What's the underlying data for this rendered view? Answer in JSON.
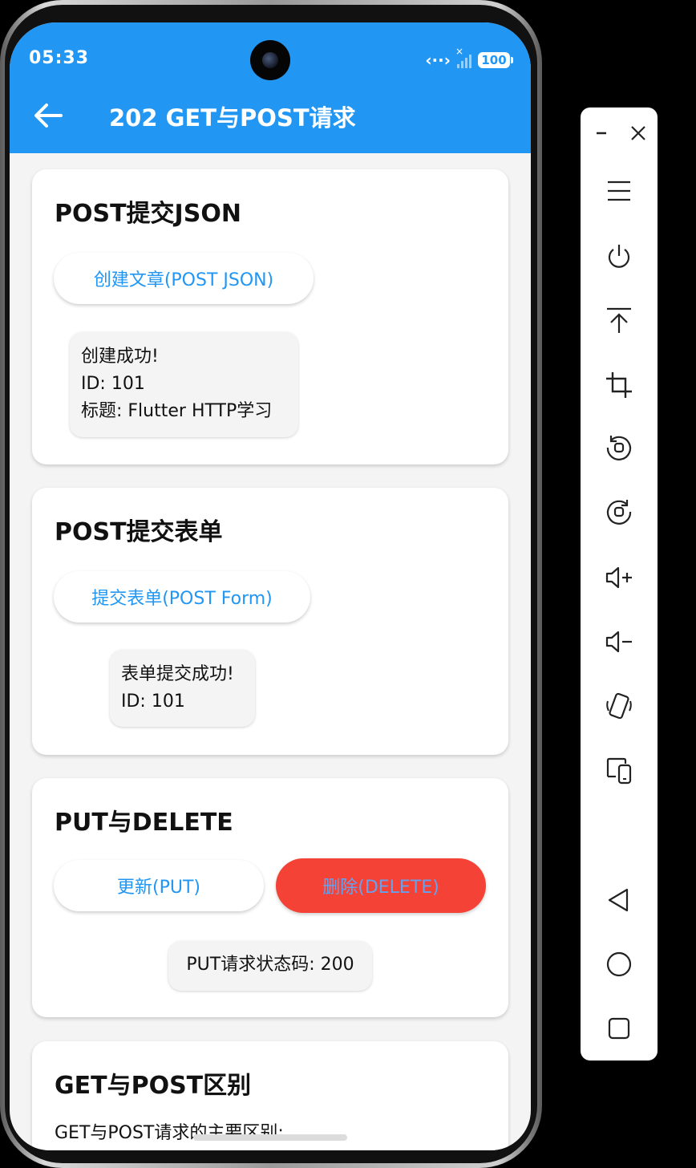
{
  "status_bar": {
    "time": "05:33",
    "battery": "100",
    "network_symbol": "‹··›",
    "signal_x": "×"
  },
  "app_bar": {
    "title": "202 GET与POST请求"
  },
  "cards": {
    "post_json": {
      "title": "POST提交JSON",
      "button_label": "创建文章(POST JSON)",
      "result_lines": [
        "创建成功!",
        "ID: 101",
        "标题: Flutter HTTP学习"
      ]
    },
    "post_form": {
      "title": "POST提交表单",
      "button_label": "提交表单(POST Form)",
      "result_lines": [
        "表单提交成功!",
        "ID: 101"
      ]
    },
    "put_delete": {
      "title": "PUT与DELETE",
      "put_label": "更新(PUT)",
      "delete_label": "删除(DELETE)",
      "status_text": "PUT请求状态码: 200"
    },
    "difference": {
      "title": "GET与POST区别",
      "intro": "GET与POST请求的主要区别:"
    }
  },
  "colors": {
    "primary": "#2196f3",
    "danger": "#f44336",
    "background": "#f4f4f4"
  },
  "toolbar_icons": [
    "minimize-icon",
    "close-icon",
    "menu-icon",
    "power-icon",
    "pin-top-icon",
    "crop-icon",
    "rotate-left-icon",
    "rotate-right-icon",
    "volume-up-icon",
    "volume-down-icon",
    "shake-icon",
    "device-switch-icon",
    "back-nav-icon",
    "home-nav-icon",
    "recents-nav-icon"
  ]
}
